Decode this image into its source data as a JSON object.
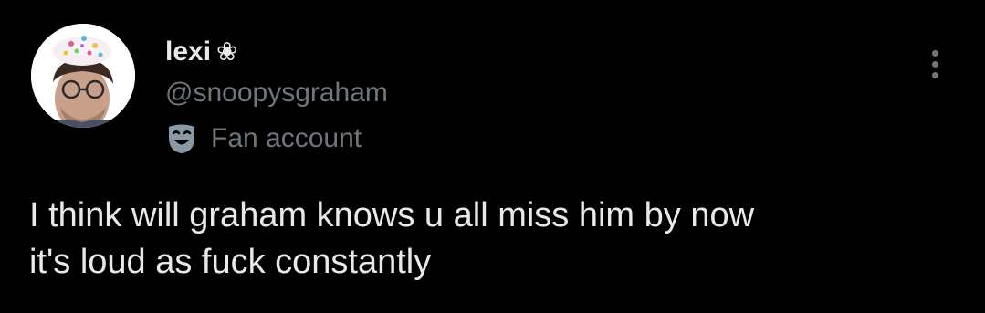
{
  "tweet": {
    "author": {
      "display_name": "lexi",
      "name_emoji": "❀",
      "handle": "@snoopysgraham",
      "label_icon": "theater-mask-icon",
      "label": "Fan account",
      "avatar": "profile-photo"
    },
    "more_icon": "more-vertical-icon",
    "text_lines": [
      "I think will graham knows u all miss him by now",
      "it's loud as fuck constantly"
    ]
  },
  "colors": {
    "background": "#000000",
    "primary_text": "#e7e9ea",
    "secondary_text": "#71767b"
  }
}
